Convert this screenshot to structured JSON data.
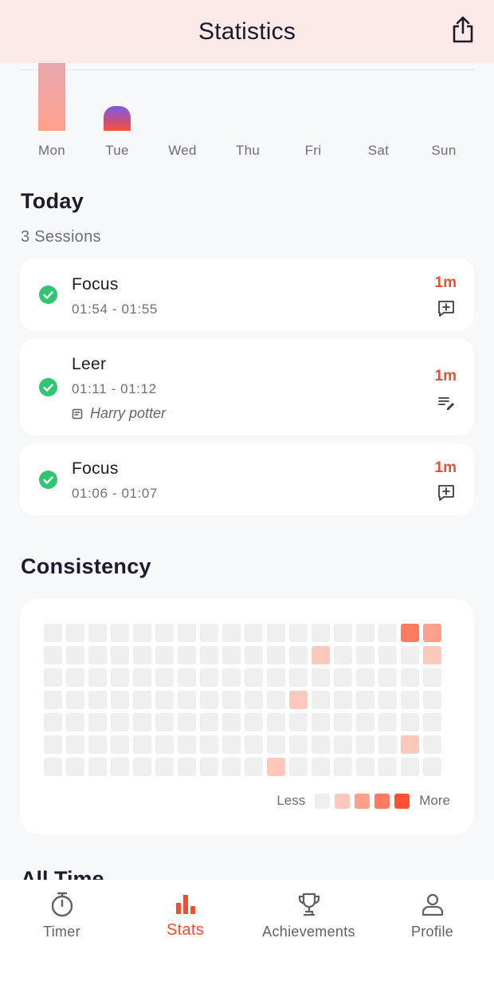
{
  "header": {
    "title": "Statistics"
  },
  "week": {
    "days": [
      {
        "label": "Mon",
        "value": 1.0,
        "style": "pink"
      },
      {
        "label": "Tue",
        "value": 0.37,
        "style": "gradient"
      },
      {
        "label": "Wed",
        "value": 0
      },
      {
        "label": "Thu",
        "value": 0
      },
      {
        "label": "Fri",
        "value": 0
      },
      {
        "label": "Sat",
        "value": 0
      },
      {
        "label": "Sun",
        "value": 0
      }
    ]
  },
  "today": {
    "title": "Today",
    "count_label": "3 Sessions",
    "sessions": [
      {
        "name": "Focus",
        "time": "01:54 - 01:55",
        "duration": "1m",
        "action_icon": "add-note-icon"
      },
      {
        "name": "Leer",
        "time": "01:11 - 01:12",
        "duration": "1m",
        "note": "Harry potter",
        "action_icon": "edit-note-icon"
      },
      {
        "name": "Focus",
        "time": "01:06 - 01:07",
        "duration": "1m",
        "action_icon": "add-note-icon"
      }
    ]
  },
  "consistency": {
    "title": "Consistency",
    "legend_less": "Less",
    "legend_more": "More",
    "levels": [
      "#efeff0",
      "#ffc8bd",
      "#ff9f8c",
      "#ff7a62",
      "#ff4f34"
    ],
    "weeks": 18,
    "days": 7,
    "active_cells": [
      {
        "week": 16,
        "day": 0,
        "level": 3
      },
      {
        "week": 17,
        "day": 0,
        "level": 2
      },
      {
        "week": 12,
        "day": 1,
        "level": 1
      },
      {
        "week": 17,
        "day": 1,
        "level": 1
      },
      {
        "week": 11,
        "day": 3,
        "level": 1
      },
      {
        "week": 16,
        "day": 5,
        "level": 1
      },
      {
        "week": 10,
        "day": 6,
        "level": 1
      }
    ]
  },
  "all_time": {
    "title": "All Time"
  },
  "tabs": [
    {
      "label": "Timer",
      "icon": "stopwatch-icon",
      "active": false
    },
    {
      "label": "Stats",
      "icon": "bar-chart-icon",
      "active": true
    },
    {
      "label": "Achievements",
      "icon": "trophy-icon",
      "active": false
    },
    {
      "label": "Profile",
      "icon": "person-icon",
      "active": false
    }
  ],
  "colors": {
    "accent": "#f24d2e",
    "check": "#2ec66e",
    "header_bg": "#fbeae8"
  }
}
